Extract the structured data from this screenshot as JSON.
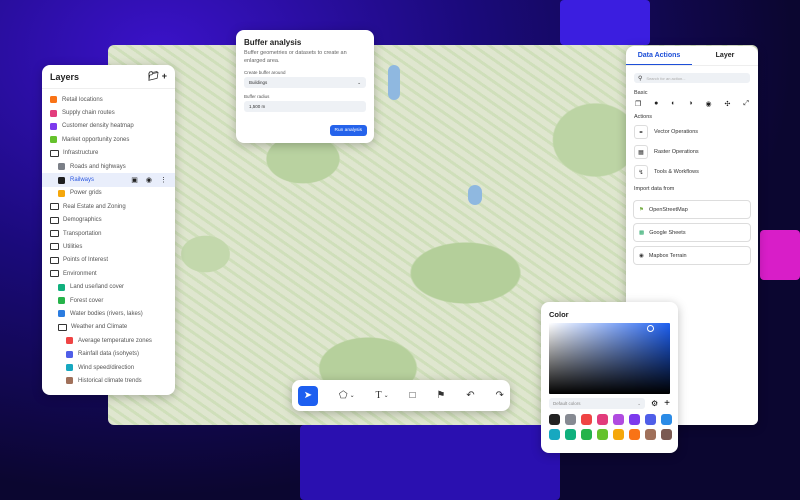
{
  "layers": {
    "title": "Layers",
    "items": [
      {
        "label": "Retail locations",
        "color": "#f97316"
      },
      {
        "label": "Supply chain routes",
        "color": "#e23c7c"
      },
      {
        "label": "Customer density heatmap",
        "color": "#7c3aed"
      },
      {
        "label": "Market opportunity zones",
        "color": "#65c22c"
      },
      {
        "label": "Infrastructure",
        "folder": true
      },
      {
        "label": "Roads and highways",
        "color": "#7b7f87"
      },
      {
        "label": "Railways",
        "color": "#1f1f1f"
      },
      {
        "label": "Power grids",
        "color": "#f5a70b"
      },
      {
        "label": "Real Estate and Zoning",
        "folder": true
      },
      {
        "label": "Demographics",
        "folder": true
      },
      {
        "label": "Transportation",
        "folder": true
      },
      {
        "label": "Utilities",
        "folder": true
      },
      {
        "label": "Points of Interest",
        "folder": true
      },
      {
        "label": "Environment",
        "folder": true
      },
      {
        "label": "Land use/land cover",
        "color": "#10b07d"
      },
      {
        "label": "Forest cover",
        "color": "#26b34a"
      },
      {
        "label": "Water bodies (rivers, lakes)",
        "color": "#2b7ce0"
      },
      {
        "label": "Weather and Climate",
        "folder": true
      },
      {
        "label": "Average temperature zones",
        "color": "#ef4444"
      },
      {
        "label": "Rainfall data (isohyets)",
        "color": "#4f5ee8"
      },
      {
        "label": "Wind speed/direction",
        "color": "#17a8c0"
      },
      {
        "label": "Historical climate trends",
        "color": "#a0705a"
      }
    ]
  },
  "buffer": {
    "title": "Buffer analysis",
    "description": "Buffer geometries or datasets to create an enlarged area.",
    "around_label": "Create buffer around",
    "around_value": "Buildings",
    "radius_label": "Buffer radius",
    "radius_value": "1,500 m",
    "run": "Run analysis"
  },
  "actions": {
    "tabs": [
      "Data Actions",
      "Layer"
    ],
    "search_placeholder": "Search for an action...",
    "basic": "Basic",
    "actions_title": "Actions",
    "items": [
      "Vector Operations",
      "Raster Operations",
      "Tools & Workflows"
    ],
    "import_title": "Import data from",
    "imports": [
      "OpenStreetMap",
      "Google Sheets",
      "Mapbox Terrain"
    ]
  },
  "color": {
    "title": "Color",
    "palette": "Default colors",
    "swatches": [
      "#222222",
      "#868a92",
      "#ef4444",
      "#e23c7c",
      "#b04be0",
      "#7c3aed",
      "#4f5ee8",
      "#2b8be6",
      "#17a8c0",
      "#10b07d",
      "#26b34a",
      "#65c22c",
      "#f5a70b",
      "#f97316",
      "#a0705a",
      "#7a5a52"
    ]
  }
}
